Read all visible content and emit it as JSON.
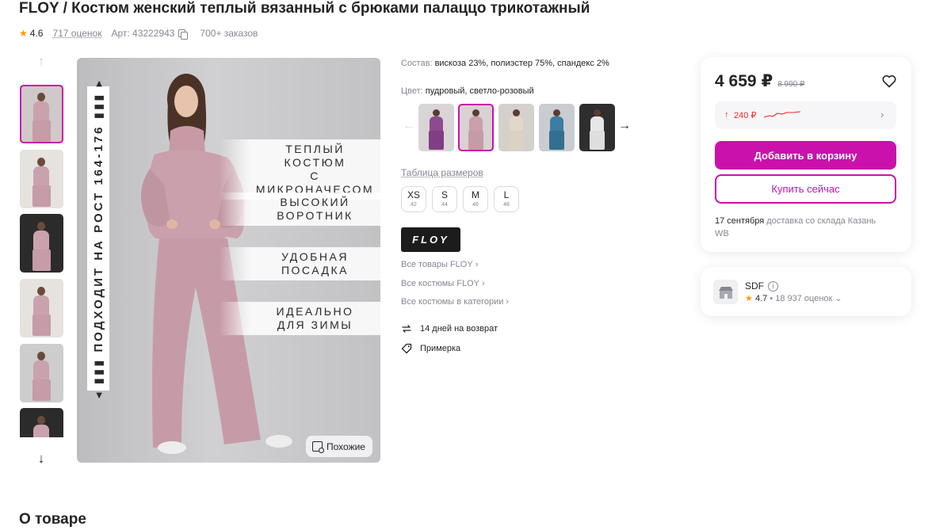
{
  "product": {
    "title": "FLOY / Костюм женский теплый вязанный с брюками палаццо трикотажный",
    "rating": "4.6",
    "reviews": "717 оценок",
    "article": "Арт: 43222943",
    "orders": "700+ заказов"
  },
  "gallery": {
    "vertical_text": "◂ ▮▮▮ ПОДХОДИТ НА РОСТ 164-176 ▮▮▮ ▸",
    "features": [
      "ТЕПЛЫЙ КОСТЮМ\nС МИКРОНАЧЕСОМ",
      "ВЫСОКИЙ\nВОРОТНИК",
      "УДОБНАЯ\nПОСАДКА",
      "ИДЕАЛЬНО\nДЛЯ ЗИМЫ"
    ],
    "similar_label": "Похожие"
  },
  "details": {
    "composition_label": "Состав:",
    "composition_value": "вискоза 23%, полиэстер 75%, спандекс 2%",
    "color_label": "Цвет:",
    "color_value": "пудровый, светло-розовый",
    "size_table_label": "Таблица размеров",
    "sizes": [
      {
        "name": "XS",
        "ru": "42"
      },
      {
        "name": "S",
        "ru": "44"
      },
      {
        "name": "M",
        "ru": "46"
      },
      {
        "name": "L",
        "ru": "48"
      }
    ],
    "brand_logo": "FLOY",
    "links": [
      "Все товары FLOY",
      "Все костюмы FLOY",
      "Все костюмы в категории"
    ],
    "return_text": "14 дней на возврат",
    "fitting_text": "Примерка"
  },
  "buy_card": {
    "price": "4 659",
    "currency": "₽",
    "old_price": "8 990 ₽",
    "price_change": "240 ₽",
    "add_to_cart": "Добавить в корзину",
    "buy_now": "Купить сейчас",
    "delivery_date": "17 сентября",
    "delivery_text": "доставка со склада Казань WB"
  },
  "seller": {
    "name": "SDF",
    "rating": "4.7",
    "reviews": "• 18 937 оценок"
  },
  "section": {
    "about": "О товаре"
  },
  "colors": {
    "accent": "#cb11ab",
    "star": "#ff9900",
    "price_up": "#f42a2a"
  }
}
